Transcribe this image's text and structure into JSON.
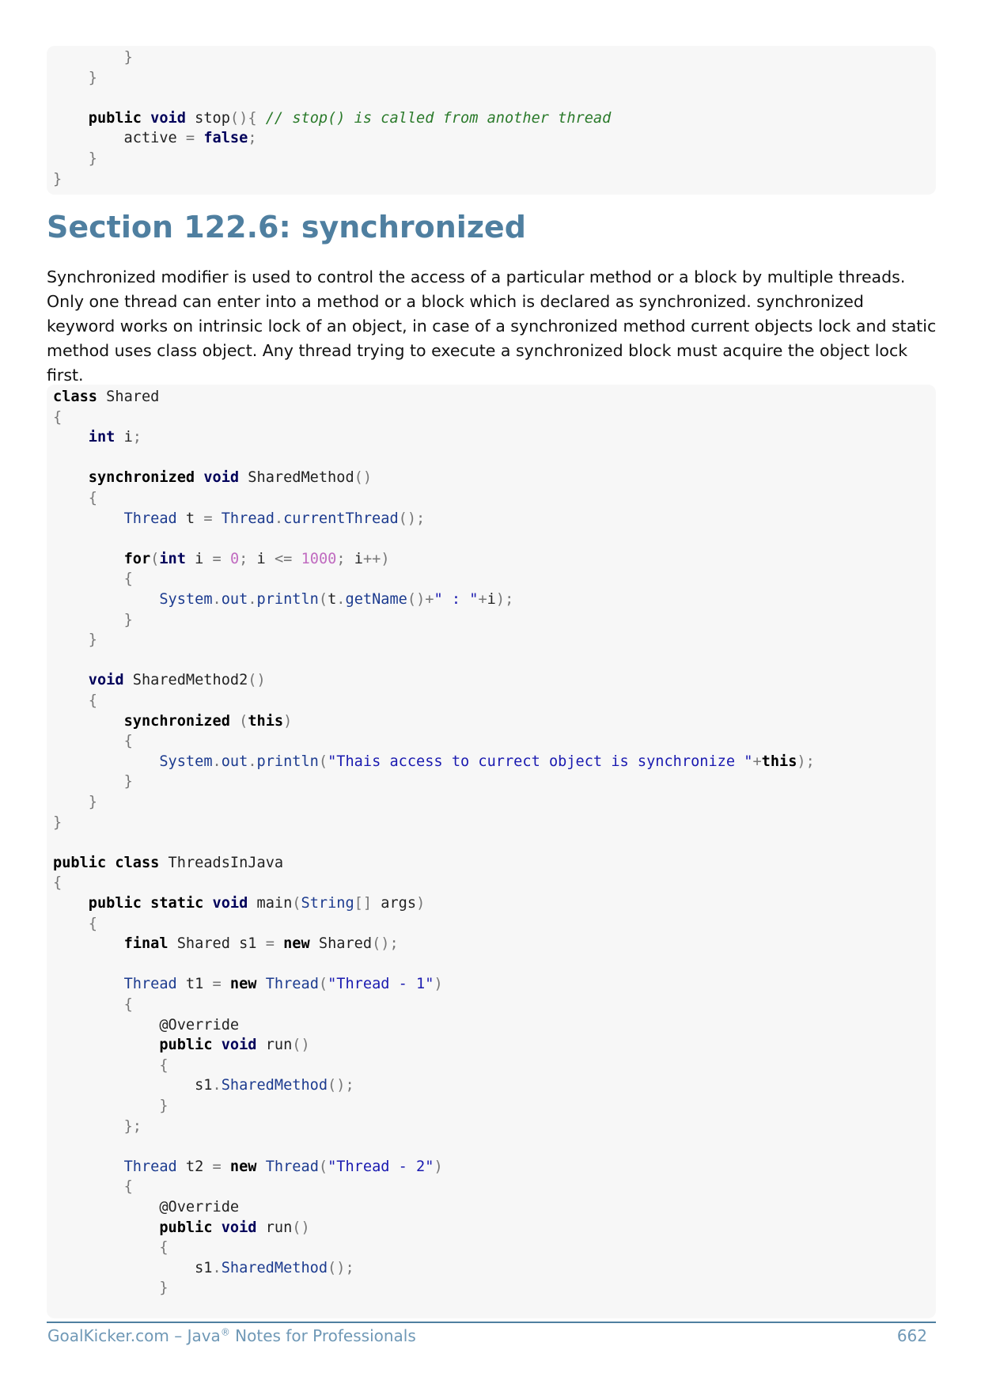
{
  "code_top": {
    "lines": [
      "        }",
      "    }",
      "",
      "    public void stop(){ // stop() is called from another thread",
      "        active = false;",
      "    }",
      "}"
    ]
  },
  "section": {
    "title": "Section 122.6: synchronized",
    "paragraph": "Synchronized modifier is used to control the access of a particular method or a block by multiple threads. Only one thread can enter into a method or a block which is declared as synchronized. synchronized keyword works on intrinsic lock of an object, in case of a synchronized method current objects lock and static method uses class object. Any thread trying to execute a synchronized block must acquire the object lock first."
  },
  "code_main": {
    "lines": [
      "class Shared",
      "{",
      "    int i;",
      "",
      "    synchronized void SharedMethod()",
      "    {",
      "        Thread t = Thread.currentThread();",
      "",
      "        for(int i = 0; i <= 1000; i++)",
      "        {",
      "            System.out.println(t.getName()+\" : \"+i);",
      "        }",
      "    }",
      "",
      "    void SharedMethod2()",
      "    {",
      "        synchronized (this)",
      "        {",
      "            System.out.println(\"Thais access to currect object is synchronize \"+this);",
      "        }",
      "    }",
      "}",
      "",
      "public class ThreadsInJava",
      "{",
      "    public static void main(String[] args)",
      "    {",
      "        final Shared s1 = new Shared();",
      "",
      "        Thread t1 = new Thread(\"Thread - 1\")",
      "        {",
      "            @Override",
      "            public void run()",
      "            {",
      "                s1.SharedMethod();",
      "            }",
      "        };",
      "",
      "        Thread t2 = new Thread(\"Thread - 2\")",
      "        {",
      "            @Override",
      "            public void run()",
      "            {",
      "                s1.SharedMethod();",
      "            }"
    ]
  },
  "footer": {
    "left_prefix": "GoalKicker.com – Java",
    "registered": "®",
    "left_suffix": " Notes for Professionals",
    "page_number": "662"
  },
  "colors": {
    "heading": "#4f7fa0",
    "footer": "#6f98b6",
    "code_background": "#f7f7f7"
  }
}
